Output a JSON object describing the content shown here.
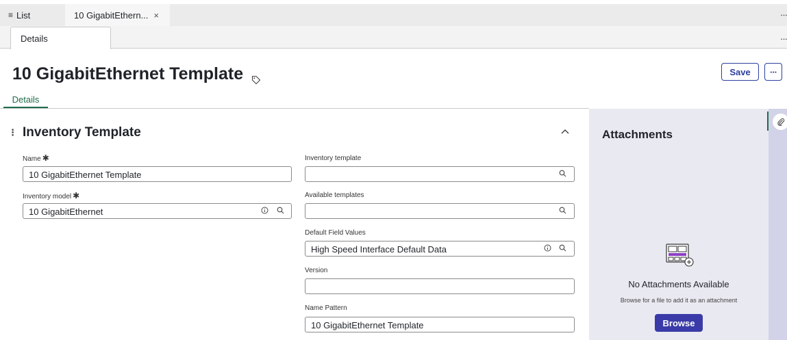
{
  "tabs": {
    "list_label": "List",
    "record_label": "10 GigabitEthern...",
    "close_glyph": "×",
    "overflow": "···"
  },
  "subtabs": {
    "details_label": "Details",
    "overflow": "···"
  },
  "header": {
    "title": "10 GigabitEthernet Template",
    "save_label": "Save",
    "more_label": "···"
  },
  "form_tabs": [
    {
      "label": "Details"
    }
  ],
  "section": {
    "title": "Inventory Template",
    "collapse_glyph": "^"
  },
  "fields": {
    "name": {
      "label": "Name",
      "required": "✱",
      "value": "10 GigabitEthernet Template"
    },
    "inventory_model": {
      "label": "Inventory model",
      "required": "✱",
      "value": "10 GigabitEthernet"
    },
    "inventory_template": {
      "label": "Inventory template",
      "value": ""
    },
    "available_templates": {
      "label": "Available templates",
      "value": ""
    },
    "default_field_values": {
      "label": "Default Field Values",
      "value": "High Speed Interface Default Data"
    },
    "version": {
      "label": "Version",
      "value": ""
    },
    "name_pattern": {
      "label": "Name Pattern",
      "value": "10 GigabitEthernet Template"
    }
  },
  "attachments": {
    "title": "Attachments",
    "empty_title": "No Attachments Available",
    "empty_hint": "Browse for a file to add it as an attachment",
    "browse_label": "Browse"
  },
  "icons": {
    "search": "search-icon",
    "info": "info-icon",
    "tag": "tag-icon",
    "paperclip": "paperclip-icon"
  },
  "colors": {
    "primary": "#2c3e9e",
    "browse": "#3a3ba8",
    "active_tab": "#1e6b4a",
    "panel_bg": "#e9e9f1",
    "rail_bg": "#d2d2e8"
  }
}
